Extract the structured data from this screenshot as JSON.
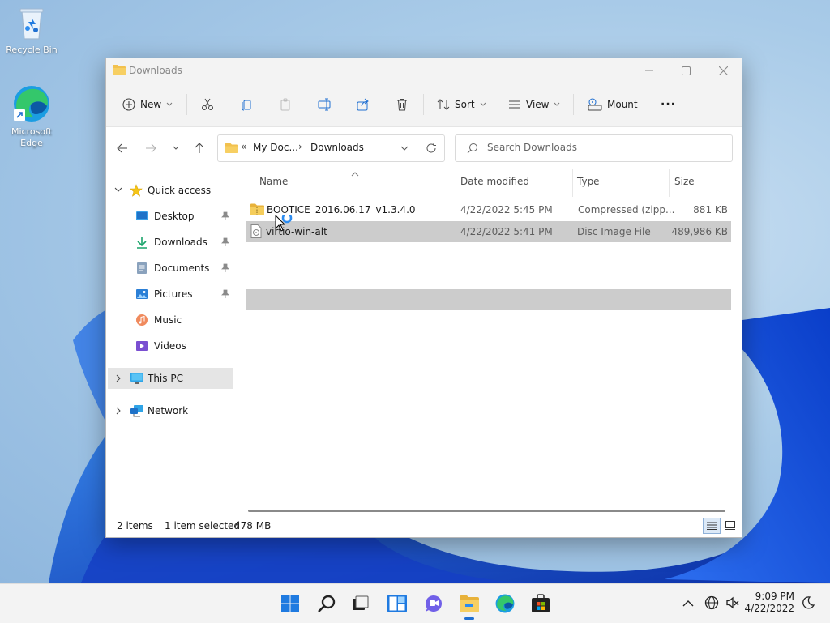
{
  "desktop": {
    "icons": [
      {
        "label": "Recycle Bin"
      },
      {
        "label": "Microsoft Edge"
      }
    ]
  },
  "window": {
    "title": "Downloads",
    "controls": {
      "minimize": "minimize-icon",
      "maximize": "maximize-icon",
      "close": "close-icon"
    }
  },
  "toolbar": {
    "new_label": "New",
    "sort_label": "Sort",
    "view_label": "View",
    "mount_label": "Mount",
    "more_label": "···"
  },
  "navigation": {
    "breadcrumb_prefix": "«",
    "breadcrumb": [
      "My Doc...",
      "Downloads"
    ],
    "search_placeholder": "Search Downloads"
  },
  "sidebar": {
    "quick_access": "Quick access",
    "items": [
      {
        "label": "Desktop",
        "pinned": true
      },
      {
        "label": "Downloads",
        "pinned": true
      },
      {
        "label": "Documents",
        "pinned": true
      },
      {
        "label": "Pictures",
        "pinned": true
      },
      {
        "label": "Music",
        "pinned": false
      },
      {
        "label": "Videos",
        "pinned": false
      }
    ],
    "this_pc": "This PC",
    "network": "Network"
  },
  "file_list": {
    "columns": [
      "Name",
      "Date modified",
      "Type",
      "Size"
    ],
    "files": [
      {
        "name": "BOOTICE_2016.06.17_v1.3.4.0",
        "date": "4/22/2022 5:45 PM",
        "type": "Compressed (zipp...",
        "size": "881 KB"
      },
      {
        "name": "virtio-win-alt",
        "date": "4/22/2022 5:41 PM",
        "type": "Disc Image File",
        "size": "489,986 KB"
      }
    ]
  },
  "status": {
    "item_count": "2 items",
    "selection": "1 item selected",
    "size": "478 MB"
  },
  "taskbar": {
    "time": "9:09 PM",
    "date": "4/22/2022"
  },
  "colors": {
    "accent": "#1f6fd1",
    "folder": "#f2c14e",
    "selection": "#cccccc"
  }
}
